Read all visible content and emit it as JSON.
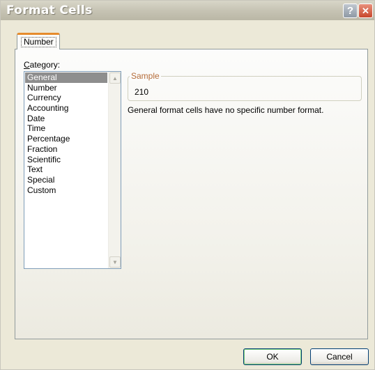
{
  "window": {
    "title": "Format Cells",
    "help_glyph": "?",
    "close_glyph": "✕"
  },
  "tabs": [
    {
      "label": "Number",
      "active": true
    }
  ],
  "category": {
    "label_prefix": "C",
    "label_rest": "ategory:",
    "items": [
      "General",
      "Number",
      "Currency",
      "Accounting",
      "Date",
      "Time",
      "Percentage",
      "Fraction",
      "Scientific",
      "Text",
      "Special",
      "Custom"
    ],
    "selected": "General"
  },
  "sample": {
    "legend": "Sample",
    "value": "210"
  },
  "description": "General format cells have no specific number format.",
  "buttons": {
    "ok": "OK",
    "cancel": "Cancel"
  },
  "scrollbar": {
    "up_glyph": "▲",
    "down_glyph": "▼"
  }
}
